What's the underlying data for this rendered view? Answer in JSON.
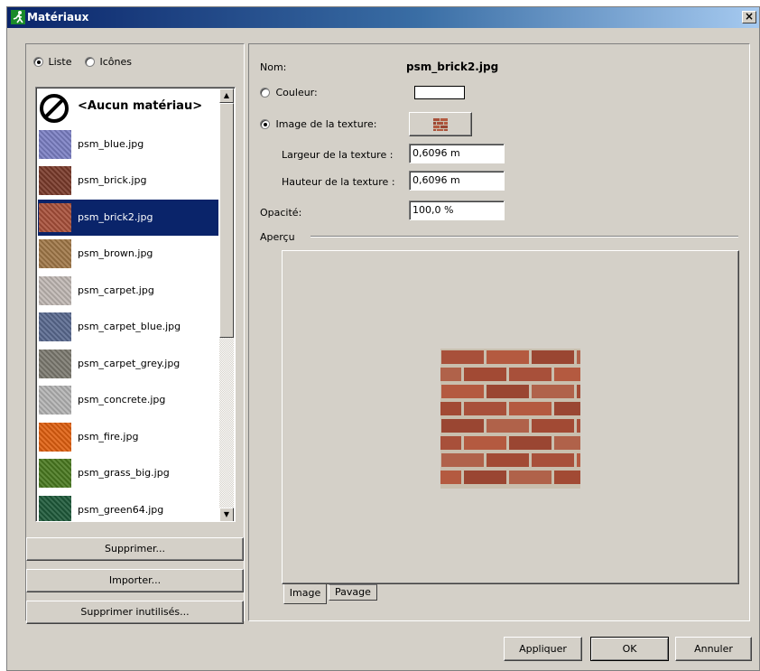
{
  "window": {
    "title": "Matériaux",
    "close_label": "×"
  },
  "view_mode": {
    "list_label": "Liste",
    "icons_label": "Icônes",
    "selected": "Liste"
  },
  "materials": [
    {
      "label": "<Aucun matériau>",
      "thumb": "none-icon"
    },
    {
      "label": "psm_blue.jpg",
      "thumb": "#7b7fc4"
    },
    {
      "label": "psm_brick.jpg",
      "thumb": "#7a3a2a"
    },
    {
      "label": "psm_brick2.jpg",
      "thumb": "#a8503a",
      "selected": true
    },
    {
      "label": "psm_brown.jpg",
      "thumb": "#a07848"
    },
    {
      "label": "psm_carpet.jpg",
      "thumb": "#c0b8b4"
    },
    {
      "label": "psm_carpet_blue.jpg",
      "thumb": "#5a6a90"
    },
    {
      "label": "psm_carpet_grey.jpg",
      "thumb": "#7c7a70"
    },
    {
      "label": "psm_concrete.jpg",
      "thumb": "#b4b4b4"
    },
    {
      "label": "psm_fire.jpg",
      "thumb": "#e06010"
    },
    {
      "label": "psm_grass_big.jpg",
      "thumb": "#4a7a20"
    },
    {
      "label": "psm_green64.jpg",
      "thumb": "#1e5a3a"
    }
  ],
  "buttons": {
    "delete": "Supprimer...",
    "import": "Importer...",
    "delete_unused": "Supprimer inutilisés...",
    "apply": "Appliquer",
    "ok": "OK",
    "cancel": "Annuler"
  },
  "properties": {
    "name_label": "Nom:",
    "name_value": "psm_brick2.jpg",
    "color_label": "Couleur:",
    "texture_label": "Image de la texture:",
    "width_label": "Largeur de la texture :",
    "width_value": "0,6096 m",
    "height_label": "Hauteur de la texture :",
    "height_value": "0,6096 m",
    "opacity_label": "Opacité:",
    "opacity_value": "100,0 %",
    "selected_mode": "texture"
  },
  "preview": {
    "group_label": "Aperçu",
    "tabs": [
      "Image",
      "Pavage"
    ],
    "active_tab": "Image"
  },
  "colors": {
    "selection": "#0a246a",
    "brick": "#a8503a",
    "mortar": "#c9bfae"
  }
}
